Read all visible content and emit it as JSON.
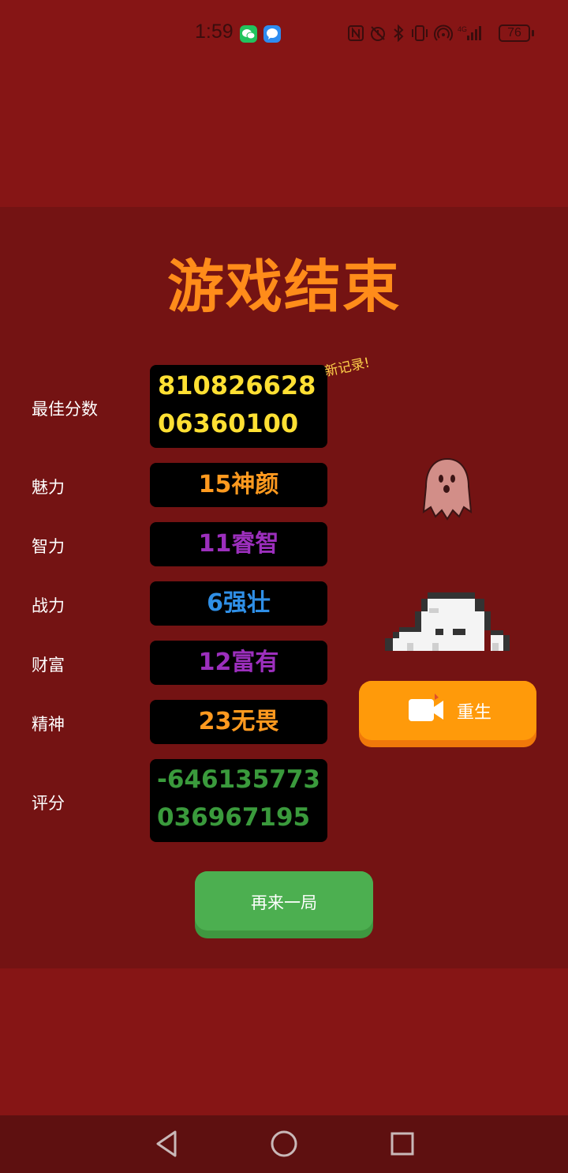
{
  "status_bar": {
    "time": "1:59",
    "battery": "76",
    "icons": [
      "wechat-icon",
      "message-icon",
      "nfc-icon",
      "alarm-icon",
      "bluetooth-icon",
      "vibrate-icon",
      "hotspot-icon",
      "4g-signal-icon",
      "battery-icon"
    ]
  },
  "game": {
    "title": "游戏结束",
    "new_record": "新记录!",
    "best_score": {
      "label": "最佳分数",
      "value": "81082662806360100",
      "color": "#ffe033"
    },
    "stats": [
      {
        "label": "魅力",
        "value": "15神颜",
        "color": "#ff9a1f"
      },
      {
        "label": "智力",
        "value": "11睿智",
        "color": "#9c2fbd"
      },
      {
        "label": "战力",
        "value": "6强壮",
        "color": "#2f8fe6"
      },
      {
        "label": "财富",
        "value": "12富有",
        "color": "#9c2fbd"
      },
      {
        "label": "精神",
        "value": "23无畏",
        "color": "#ff9a1f"
      }
    ],
    "rating": {
      "label": "评分",
      "value": "-646135773036967195",
      "color": "#3a9a3c"
    },
    "rebirth_button": "重生",
    "play_again_button": "再来一局"
  },
  "colors": {
    "background": "#861515",
    "panel": "#741313",
    "title": "#ff8c1a",
    "rebirth": "#ff9a0a",
    "play_again": "#4caf50"
  },
  "navigation": {
    "icons": [
      "back-icon",
      "home-icon",
      "recents-icon"
    ]
  }
}
